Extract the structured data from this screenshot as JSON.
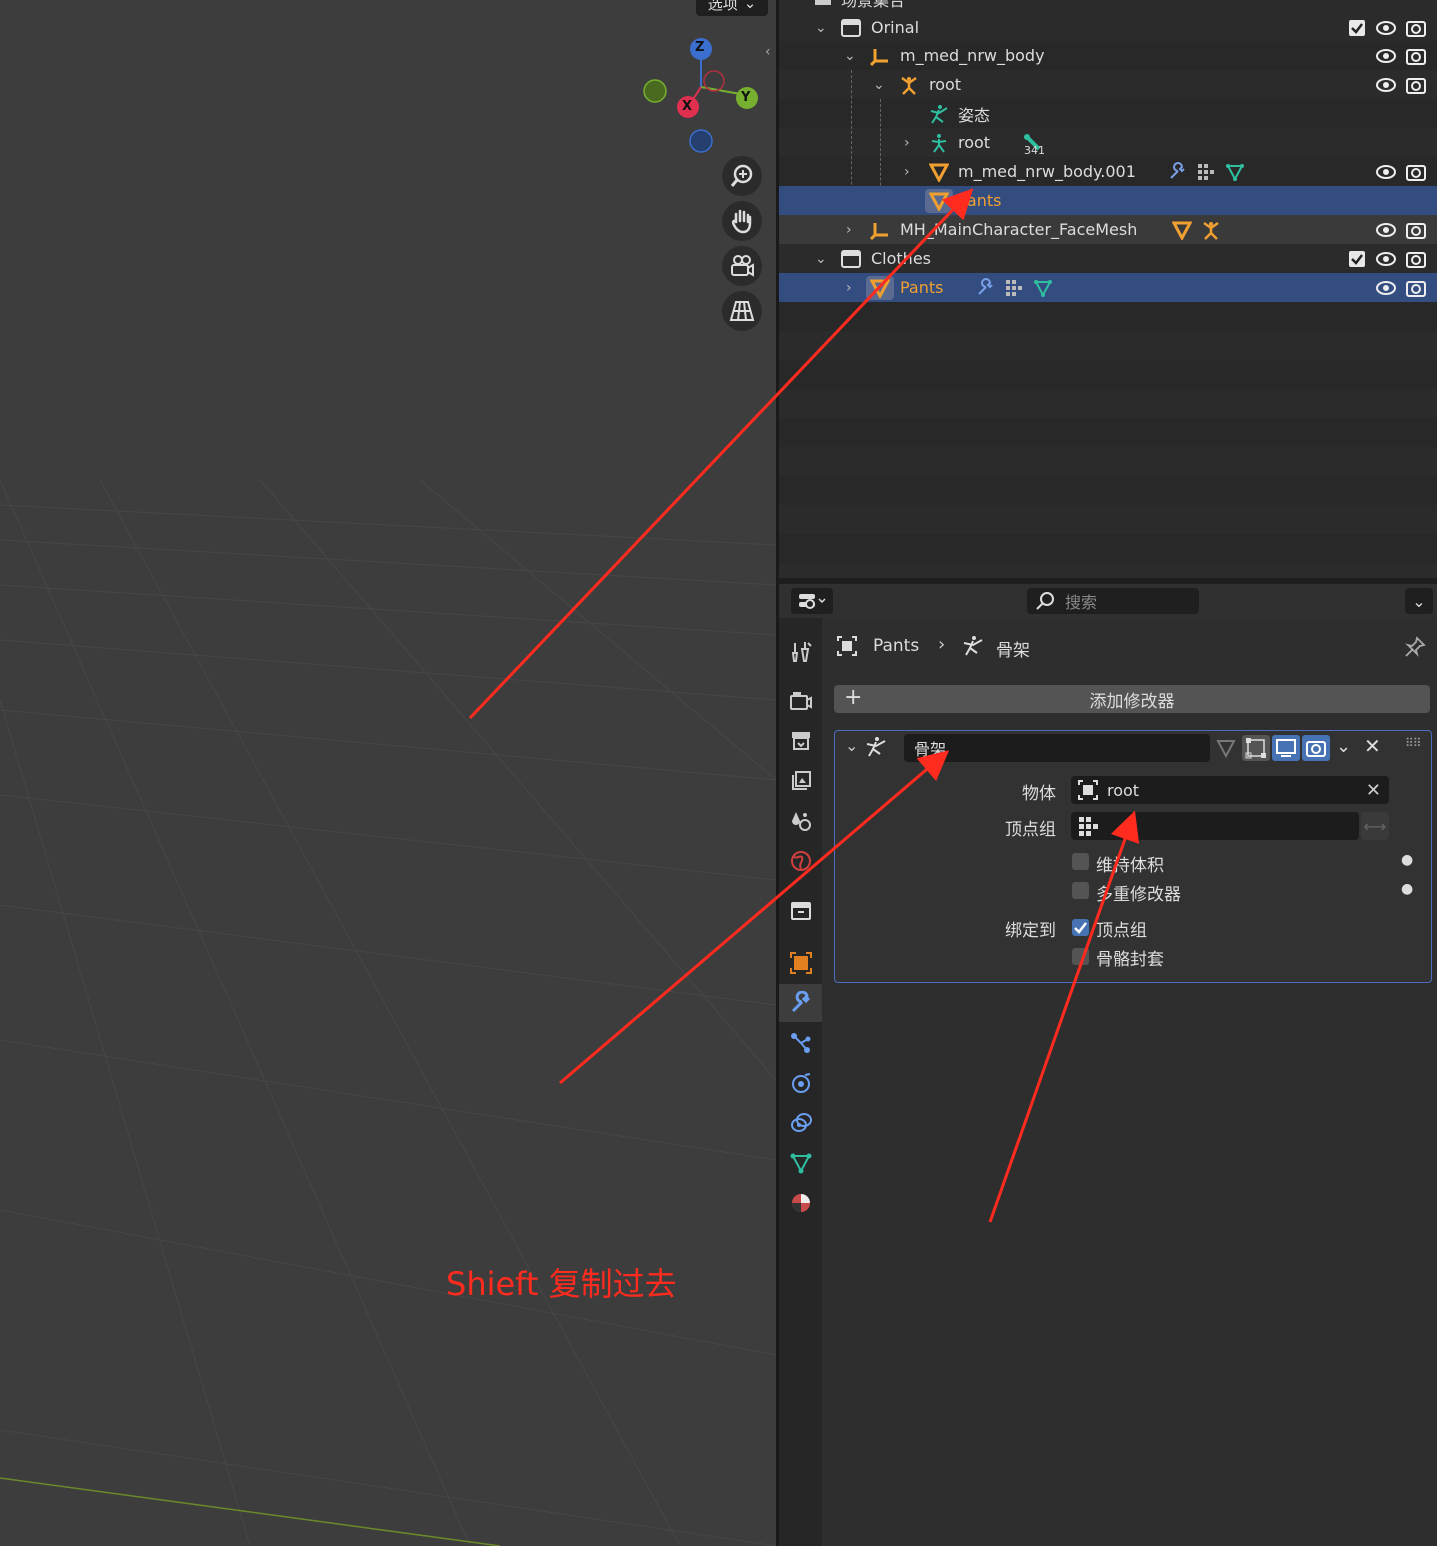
{
  "viewport": {
    "options_label": "选项",
    "gizmo": {
      "z": "Z",
      "y": "Y",
      "x": "X"
    },
    "annotation": "Shieft 复制过去",
    "nav_buttons": [
      "zoom-icon",
      "hand-pan-icon",
      "camera-icon",
      "grid-perspective-icon"
    ]
  },
  "outliner": {
    "top_partial": "场景集合",
    "rows": [
      {
        "label": "Orinal",
        "type": "collection"
      },
      {
        "label": "m_med_nrw_body",
        "type": "armature-object"
      },
      {
        "label": "root",
        "type": "armature-data"
      },
      {
        "label": "姿态",
        "type": "pose"
      },
      {
        "label": "root",
        "type": "bones",
        "count": "341"
      },
      {
        "label": "m_med_nrw_body.001",
        "type": "mesh"
      },
      {
        "label": "Pants",
        "type": "mesh",
        "state": "selected-orange"
      },
      {
        "label": "MH_MainCharacter_FaceMesh",
        "type": "armature-object"
      },
      {
        "label": "Clothes",
        "type": "collection"
      },
      {
        "label": "Pants",
        "type": "mesh",
        "state": "selected-orange"
      }
    ]
  },
  "properties": {
    "search_placeholder": "搜索",
    "breadcrumb": {
      "object": "Pants",
      "modifier": "骨架"
    },
    "add_modifier": "添加修改器",
    "modifier": {
      "name": "骨架",
      "object_label": "物体",
      "object_value": "root",
      "vgroup_label": "顶点组",
      "vgroup_value": "",
      "preserve_volume": "维持体积",
      "multi_modifier": "多重修改器",
      "bind_to_label": "绑定到",
      "bind_vertex_groups": "顶点组",
      "bind_bone_envelopes": "骨骼封套"
    }
  },
  "colors": {
    "accent_blue": "#4772b3",
    "selection": "#334d80",
    "annotation_red": "#ff2b1f",
    "orange": "#f0a030"
  }
}
